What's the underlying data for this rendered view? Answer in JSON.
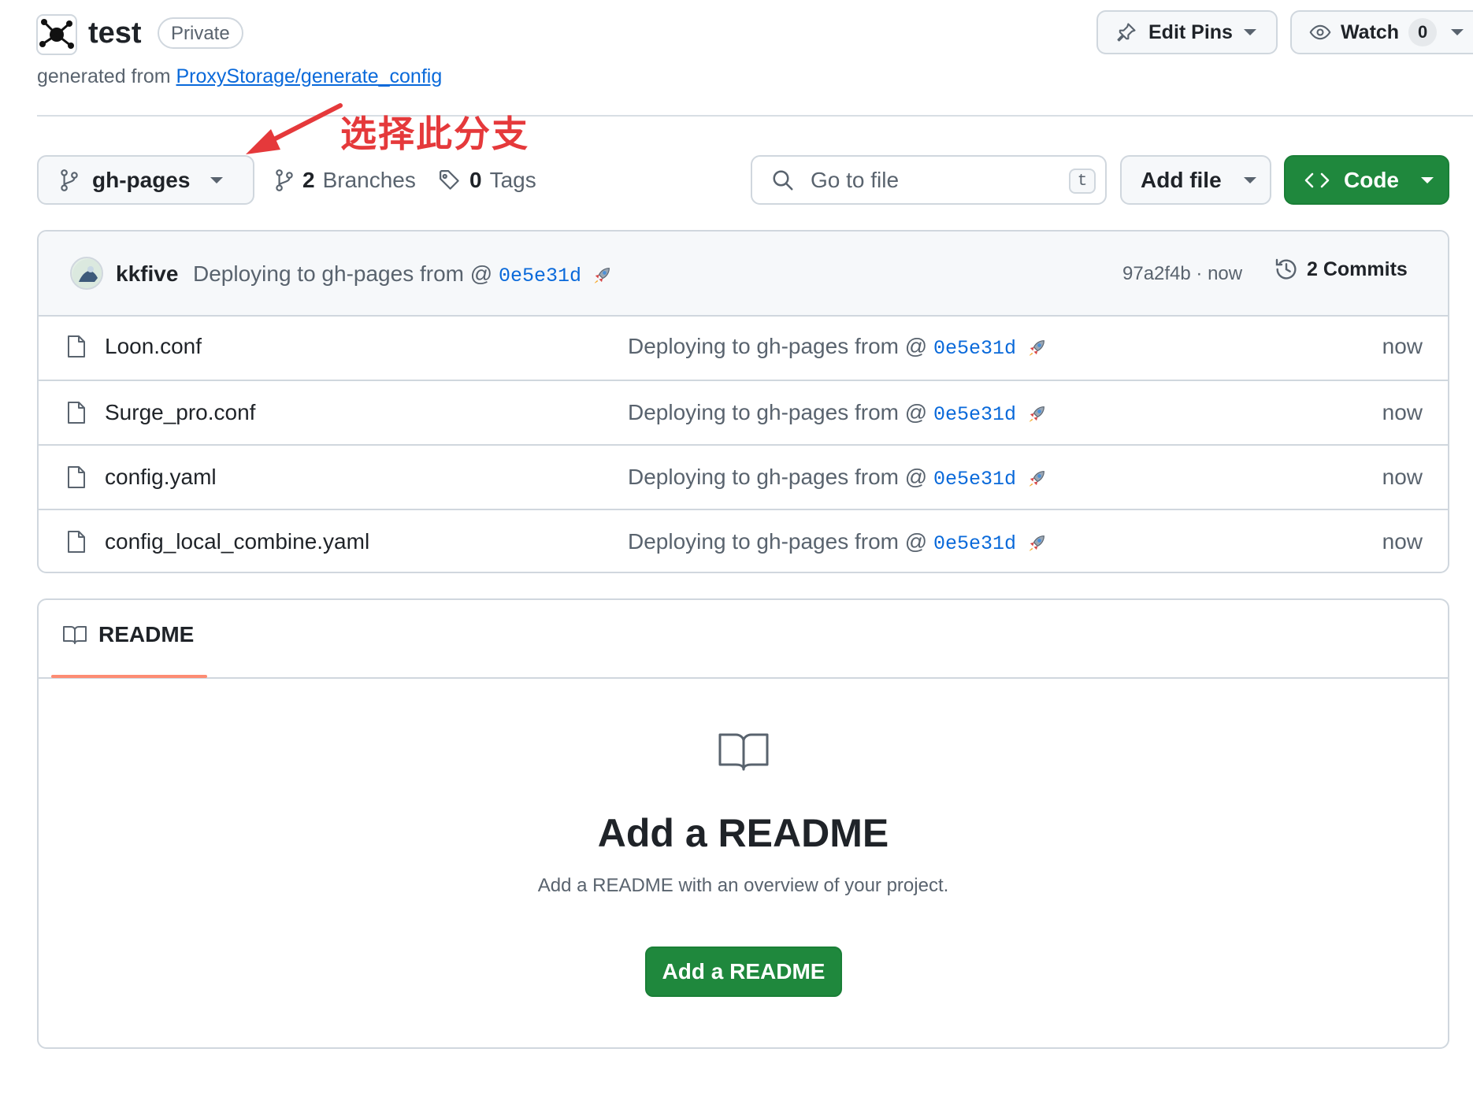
{
  "header": {
    "repo_name": "test",
    "visibility": "Private",
    "generated_prefix": "generated from",
    "template_link": "ProxyStorage/generate_config",
    "edit_pins_label": "Edit Pins",
    "watch_label": "Watch",
    "watch_count": "0"
  },
  "annotation": {
    "text": "选择此分支",
    "color": "#e5393b"
  },
  "toolbar": {
    "branch": "gh-pages",
    "branches_count": "2",
    "branches_label": "Branches",
    "tags_count": "0",
    "tags_label": "Tags",
    "goto_placeholder": "Go to file",
    "goto_shortcut": "t",
    "add_file_label": "Add file",
    "code_label": "Code"
  },
  "latest_commit": {
    "author": "kkfive",
    "message_prefix": "Deploying to gh-pages from @",
    "sha_ref": "0e5e31d",
    "hash": "97a2f4b · now",
    "commits_label": "2 Commits"
  },
  "files": [
    {
      "name": "Loon.conf",
      "msg_prefix": "Deploying to gh-pages from @",
      "sha": "0e5e31d",
      "time": "now"
    },
    {
      "name": "Surge_pro.conf",
      "msg_prefix": "Deploying to gh-pages from @",
      "sha": "0e5e31d",
      "time": "now"
    },
    {
      "name": "config.yaml",
      "msg_prefix": "Deploying to gh-pages from @",
      "sha": "0e5e31d",
      "time": "now"
    },
    {
      "name": "config_local_combine.yaml",
      "msg_prefix": "Deploying to gh-pages from @",
      "sha": "0e5e31d",
      "time": "now"
    }
  ],
  "readme": {
    "tab_label": "README",
    "title": "Add a README",
    "subtitle": "Add a README with an overview of your project.",
    "button_label": "Add a README"
  },
  "colors": {
    "accent_green": "#1f883d",
    "link_blue": "#0969da",
    "tab_underline": "#fd8c73"
  }
}
